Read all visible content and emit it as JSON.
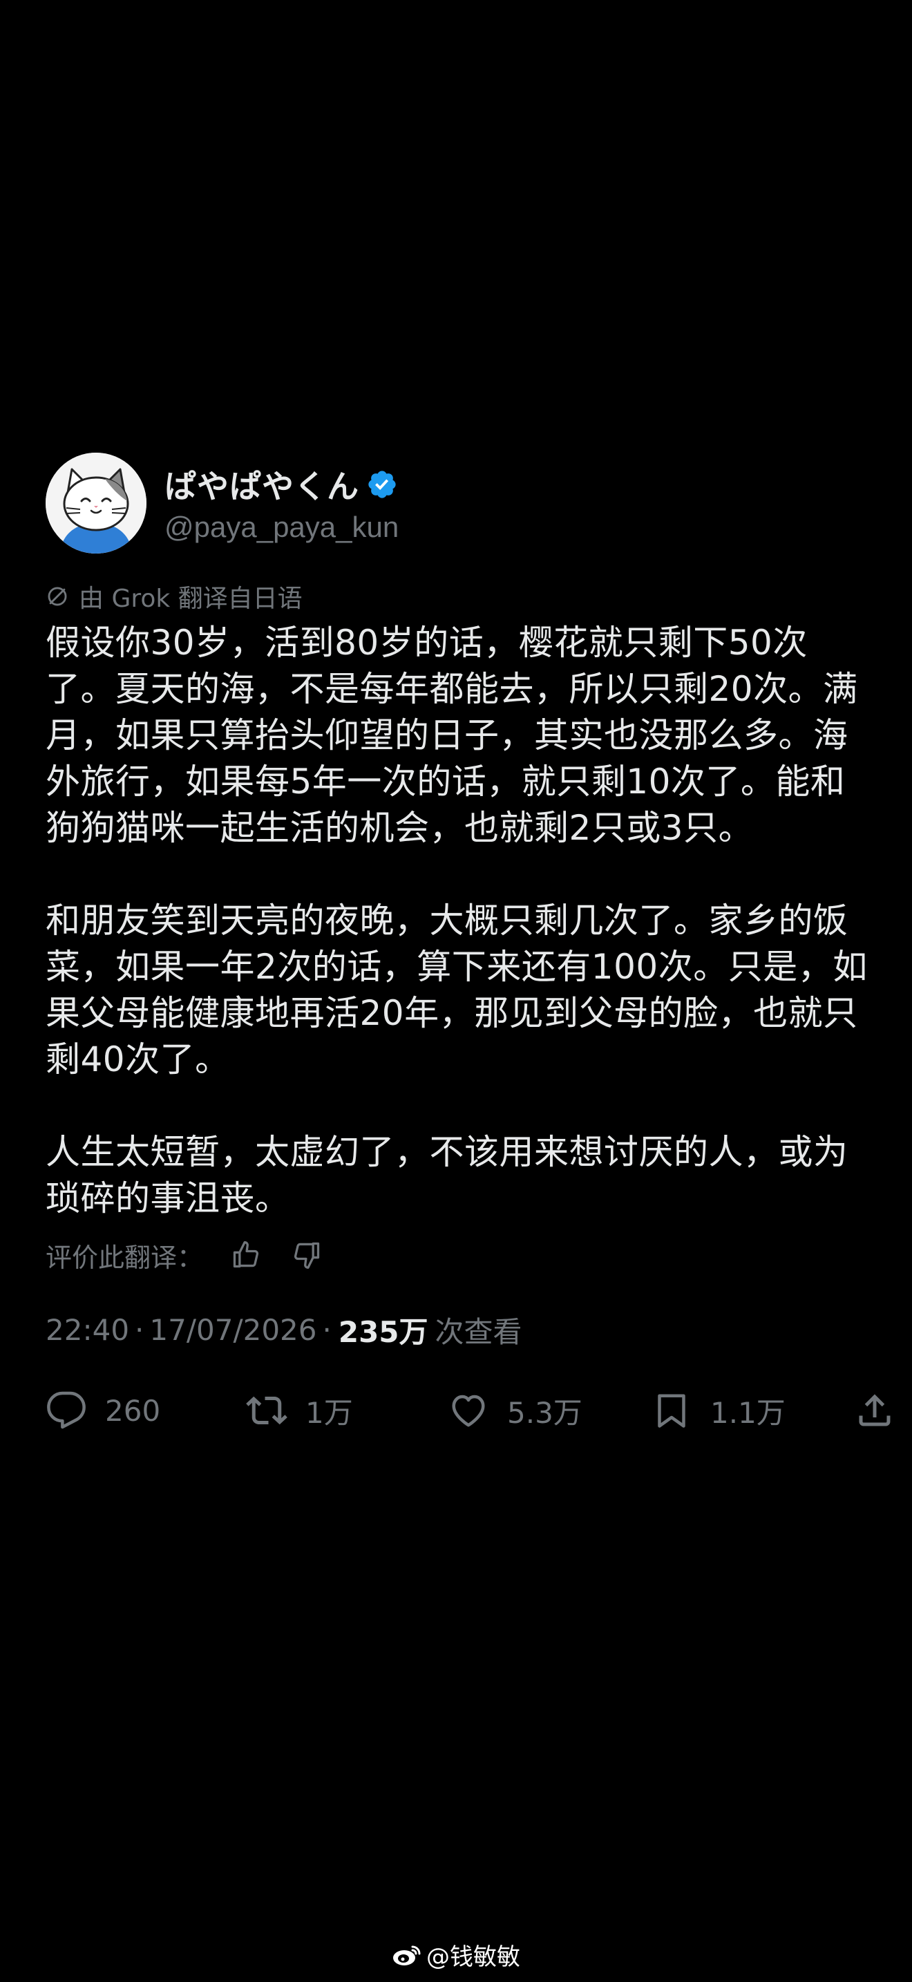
{
  "author": {
    "display_name": "ぱやぱやくん",
    "handle": "@paya_paya_kun",
    "verified": true,
    "verified_color": "#1d9bf0",
    "avatar": "cat-avatar"
  },
  "translation_note": "由 Grok 翻译自日语",
  "body": [
    "假设你30岁，活到80岁的话，樱花就只剩下50次了。夏天的海，不是每年都能去，所以只剩20次。满月，如果只算抬头仰望的日子，其实也没那么多。海外旅行，如果每5年一次的话，就只剩10次了。能和狗狗猫咪一起生活的机会，也就剩2只或3只。",
    "和朋友笑到天亮的夜晚，大概只剩几次了。家乡的饭菜，如果一年2次的话，算下来还有100次。只是，如果父母能健康地再活20年，那见到父母的脸，也就只剩40次了。",
    "人生太短暂，太虚幻了，不该用来想讨厌的人，或为琐碎的事沮丧。"
  ],
  "rate_translation": {
    "label": "评价此翻译：",
    "up_icon": "thumbs-up-icon",
    "down_icon": "thumbs-down-icon"
  },
  "meta": {
    "time": "22:40",
    "date": "17/07/2026",
    "sep": "·",
    "views": "235万",
    "views_label": "次查看"
  },
  "actions": {
    "reply": {
      "icon": "reply-icon",
      "count": "260"
    },
    "repost": {
      "icon": "repost-icon",
      "count": "1万"
    },
    "like": {
      "icon": "heart-icon",
      "count": "5.3万"
    },
    "bookmark": {
      "icon": "bookmark-icon",
      "count": "1.1万"
    },
    "share": {
      "icon": "share-icon"
    }
  },
  "watermark": "@钱敏敏"
}
